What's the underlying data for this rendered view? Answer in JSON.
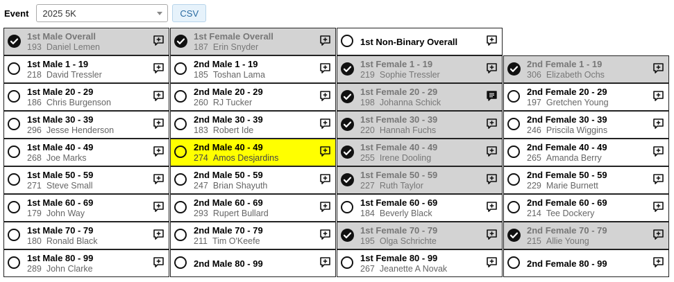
{
  "event": {
    "label": "Event",
    "selected": "2025 5K"
  },
  "csv_label": "CSV",
  "rows": [
    [
      {
        "title": "1st Male Overall",
        "bib": "193",
        "name": "Daniel Lemen",
        "state": "done",
        "icon": "note-add-icon"
      },
      {
        "title": "1st Female Overall",
        "bib": "187",
        "name": "Erin Snyder",
        "state": "done",
        "icon": "note-add-icon"
      },
      {
        "title": "1st Non-Binary Overall",
        "bib": "",
        "name": "",
        "state": "open",
        "icon": "note-add-icon"
      },
      null
    ],
    [
      {
        "title": "1st Male 1 - 19",
        "bib": "218",
        "name": "David Tressler",
        "state": "open",
        "icon": "note-add-icon"
      },
      {
        "title": "2nd Male 1 - 19",
        "bib": "185",
        "name": "Toshan Lama",
        "state": "open",
        "icon": "note-add-icon"
      },
      {
        "title": "1st Female 1 - 19",
        "bib": "219",
        "name": "Sophie Tressler",
        "state": "done",
        "icon": "note-add-icon"
      },
      {
        "title": "2nd Female 1 - 19",
        "bib": "306",
        "name": "Elizabeth Ochs",
        "state": "done",
        "icon": "note-add-icon"
      }
    ],
    [
      {
        "title": "1st Male 20 - 29",
        "bib": "186",
        "name": "Chris Burgenson",
        "state": "open",
        "icon": "note-add-icon"
      },
      {
        "title": "2nd Male 20 - 29",
        "bib": "260",
        "name": "RJ Tucker",
        "state": "open",
        "icon": "note-add-icon"
      },
      {
        "title": "1st Female 20 - 29",
        "bib": "198",
        "name": "Johanna Schick",
        "state": "done",
        "icon": "note-filled-icon"
      },
      {
        "title": "2nd Female 20 - 29",
        "bib": "197",
        "name": "Gretchen Young",
        "state": "open",
        "icon": "note-add-icon"
      }
    ],
    [
      {
        "title": "1st Male 30 - 39",
        "bib": "296",
        "name": "Jesse Henderson",
        "state": "open",
        "icon": "note-add-icon"
      },
      {
        "title": "2nd Male 30 - 39",
        "bib": "183",
        "name": "Robert Ide",
        "state": "open",
        "icon": "note-add-icon"
      },
      {
        "title": "1st Female 30 - 39",
        "bib": "220",
        "name": "Hannah Fuchs",
        "state": "done",
        "icon": "note-add-icon"
      },
      {
        "title": "2nd Female 30 - 39",
        "bib": "246",
        "name": "Priscila Wiggins",
        "state": "open",
        "icon": "note-add-icon"
      }
    ],
    [
      {
        "title": "1st Male 40 - 49",
        "bib": "268",
        "name": "Joe Marks",
        "state": "open",
        "icon": "note-add-icon"
      },
      {
        "title": "2nd Male 40 - 49",
        "bib": "274",
        "name": "Amos Desjardins",
        "state": "highlight",
        "icon": "note-add-icon"
      },
      {
        "title": "1st Female 40 - 49",
        "bib": "255",
        "name": "Irene Dooling",
        "state": "done",
        "icon": "note-add-icon"
      },
      {
        "title": "2nd Female 40 - 49",
        "bib": "265",
        "name": "Amanda Berry",
        "state": "open",
        "icon": "note-add-icon"
      }
    ],
    [
      {
        "title": "1st Male 50 - 59",
        "bib": "271",
        "name": "Steve Small",
        "state": "open",
        "icon": "note-add-icon"
      },
      {
        "title": "2nd Male 50 - 59",
        "bib": "247",
        "name": "Brian Shayuth",
        "state": "open",
        "icon": "note-add-icon"
      },
      {
        "title": "1st Female 50 - 59",
        "bib": "227",
        "name": "Ruth Taylor",
        "state": "done",
        "icon": "note-add-icon"
      },
      {
        "title": "2nd Female 50 - 59",
        "bib": "229",
        "name": "Marie Burnett",
        "state": "open",
        "icon": "note-add-icon"
      }
    ],
    [
      {
        "title": "1st Male 60 - 69",
        "bib": "179",
        "name": "John Way",
        "state": "open",
        "icon": "note-add-icon"
      },
      {
        "title": "2nd Male 60 - 69",
        "bib": "293",
        "name": "Rupert Bullard",
        "state": "open",
        "icon": "note-add-icon"
      },
      {
        "title": "1st Female 60 - 69",
        "bib": "184",
        "name": "Beverly Black",
        "state": "open",
        "icon": "note-add-icon"
      },
      {
        "title": "2nd Female 60 - 69",
        "bib": "214",
        "name": "Tee Dockery",
        "state": "open",
        "icon": "note-add-icon"
      }
    ],
    [
      {
        "title": "1st Male 70 - 79",
        "bib": "180",
        "name": "Ronald Black",
        "state": "open",
        "icon": "note-add-icon"
      },
      {
        "title": "2nd Male 70 - 79",
        "bib": "211",
        "name": "Tim O'Keefe",
        "state": "open",
        "icon": "note-add-icon"
      },
      {
        "title": "1st Female 70 - 79",
        "bib": "195",
        "name": "Olga Schrichte",
        "state": "done",
        "icon": "note-add-icon"
      },
      {
        "title": "2nd Female 70 - 79",
        "bib": "215",
        "name": "Allie Young",
        "state": "done",
        "icon": "note-add-icon"
      }
    ],
    [
      {
        "title": "1st Male 80 - 99",
        "bib": "289",
        "name": "John Clarke",
        "state": "open",
        "icon": "note-add-icon"
      },
      {
        "title": "2nd Male 80 - 99",
        "bib": "",
        "name": "",
        "state": "open",
        "icon": "note-add-icon"
      },
      {
        "title": "1st Female 80 - 99",
        "bib": "267",
        "name": "Jeanette A Novak",
        "state": "open",
        "icon": "note-add-icon"
      },
      {
        "title": "2nd Female 80 - 99",
        "bib": "",
        "name": "",
        "state": "open",
        "icon": "note-add-icon"
      }
    ]
  ]
}
